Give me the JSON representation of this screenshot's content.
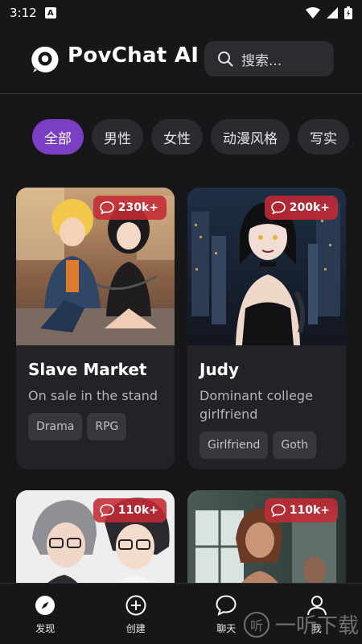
{
  "status_bar": {
    "time": "3:12",
    "notification": "A"
  },
  "header": {
    "app_title": "PovChat AI",
    "search_placeholder": "搜索..."
  },
  "tabs": [
    {
      "label": "全部",
      "active": true
    },
    {
      "label": "男性",
      "active": false
    },
    {
      "label": "女性",
      "active": false
    },
    {
      "label": "动漫风格",
      "active": false
    },
    {
      "label": "写实",
      "active": false
    }
  ],
  "cards": [
    {
      "count": "230k+",
      "title": "Slave Market",
      "description": "On sale in the stand",
      "tags": [
        "Drama",
        "RPG"
      ]
    },
    {
      "count": "200k+",
      "title": "Judy",
      "description": "Dominant college girlfriend",
      "tags": [
        "Girlfriend",
        "Goth"
      ]
    },
    {
      "count": "110k+",
      "title": "",
      "description": "",
      "tags": []
    },
    {
      "count": "110k+",
      "title": "",
      "description": "",
      "tags": []
    }
  ],
  "bottom_nav": [
    {
      "label": "发现",
      "icon": "compass-icon"
    },
    {
      "label": "创建",
      "icon": "plus-circle-icon"
    },
    {
      "label": "聊天",
      "icon": "chat-bubble-icon"
    },
    {
      "label": "我",
      "icon": "user-icon"
    }
  ],
  "watermark": "一听下载",
  "colors": {
    "accent": "#7b3fc4",
    "badge": "#c42a34",
    "background": "#17171a",
    "card": "#232327"
  }
}
